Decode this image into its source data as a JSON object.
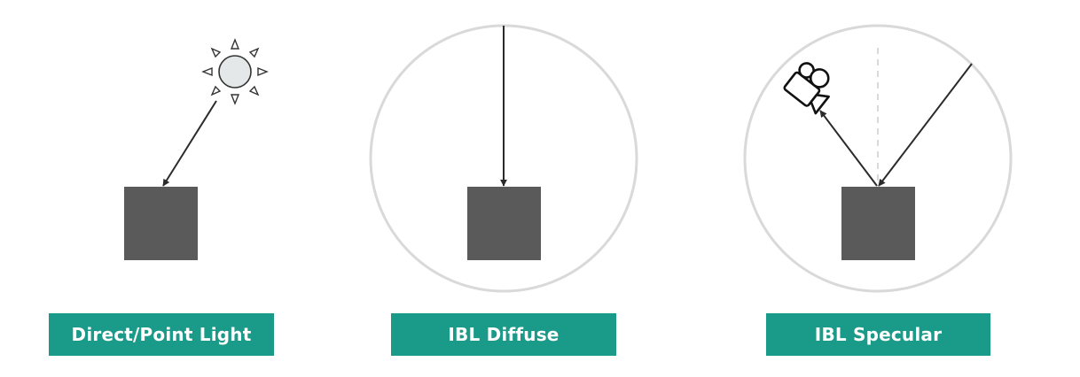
{
  "colors": {
    "label_bg": "#1a9a88",
    "object": "#5a5a5a",
    "environment": "#d9d9d9",
    "arrow": "#2b2b2b",
    "sun_fill": "#e4e8e8"
  },
  "icons": {
    "light": "sun-icon",
    "viewer": "camera-icon"
  },
  "panels": [
    {
      "label": "Direct/Point Light"
    },
    {
      "label": "IBL Diffuse"
    },
    {
      "label": "IBL Specular"
    }
  ]
}
